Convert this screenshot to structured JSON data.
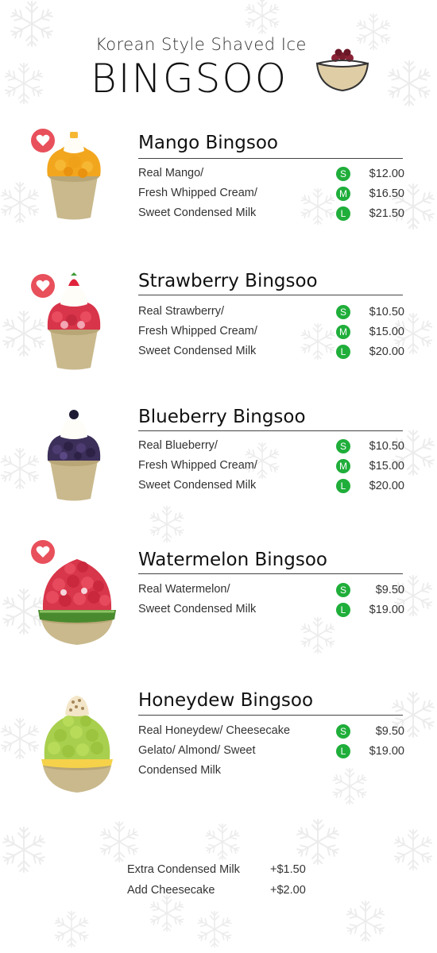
{
  "header": {
    "subtitle": "Korean Style Shaved Ice",
    "brand": "BINGSOO"
  },
  "colors": {
    "size_badge": "#1fae3a",
    "favorite": "#e8505b",
    "bowl": "#c9b98d"
  },
  "items": [
    {
      "name": "Mango Bingsoo",
      "favorite": true,
      "description": [
        "Real Mango/",
        "Fresh Whipped Cream/",
        "Sweet Condensed Milk"
      ],
      "sizes": [
        {
          "size": "S",
          "price": "$12.00"
        },
        {
          "size": "M",
          "price": "$16.50"
        },
        {
          "size": "L",
          "price": "$21.50"
        }
      ]
    },
    {
      "name": "Strawberry Bingsoo",
      "favorite": true,
      "description": [
        "Real Strawberry/",
        "Fresh Whipped Cream/",
        "Sweet Condensed Milk"
      ],
      "sizes": [
        {
          "size": "S",
          "price": "$10.50"
        },
        {
          "size": "M",
          "price": "$15.00"
        },
        {
          "size": "L",
          "price": "$20.00"
        }
      ]
    },
    {
      "name": "Blueberry Bingsoo",
      "favorite": false,
      "description": [
        "Real Blueberry/",
        "Fresh Whipped Cream/",
        "Sweet Condensed Milk"
      ],
      "sizes": [
        {
          "size": "S",
          "price": "$10.50"
        },
        {
          "size": "M",
          "price": "$15.00"
        },
        {
          "size": "L",
          "price": "$20.00"
        }
      ]
    },
    {
      "name": "Watermelon Bingsoo",
      "favorite": true,
      "description": [
        "Real Watermelon/",
        "Sweet Condensed Milk"
      ],
      "sizes": [
        {
          "size": "S",
          "price": "$9.50"
        },
        {
          "size": "L",
          "price": "$19.00"
        }
      ]
    },
    {
      "name": "Honeydew Bingsoo",
      "favorite": false,
      "description": [
        "Real Honeydew/ Cheesecake",
        "Gelato/ Almond/ Sweet",
        "Condensed Milk"
      ],
      "sizes": [
        {
          "size": "S",
          "price": "$9.50"
        },
        {
          "size": "L",
          "price": "$19.00"
        }
      ]
    }
  ],
  "extras": [
    {
      "label": "Extra Condensed Milk",
      "price": "+$1.50"
    },
    {
      "label": "Add Cheesecake",
      "price": "+$2.00"
    }
  ]
}
